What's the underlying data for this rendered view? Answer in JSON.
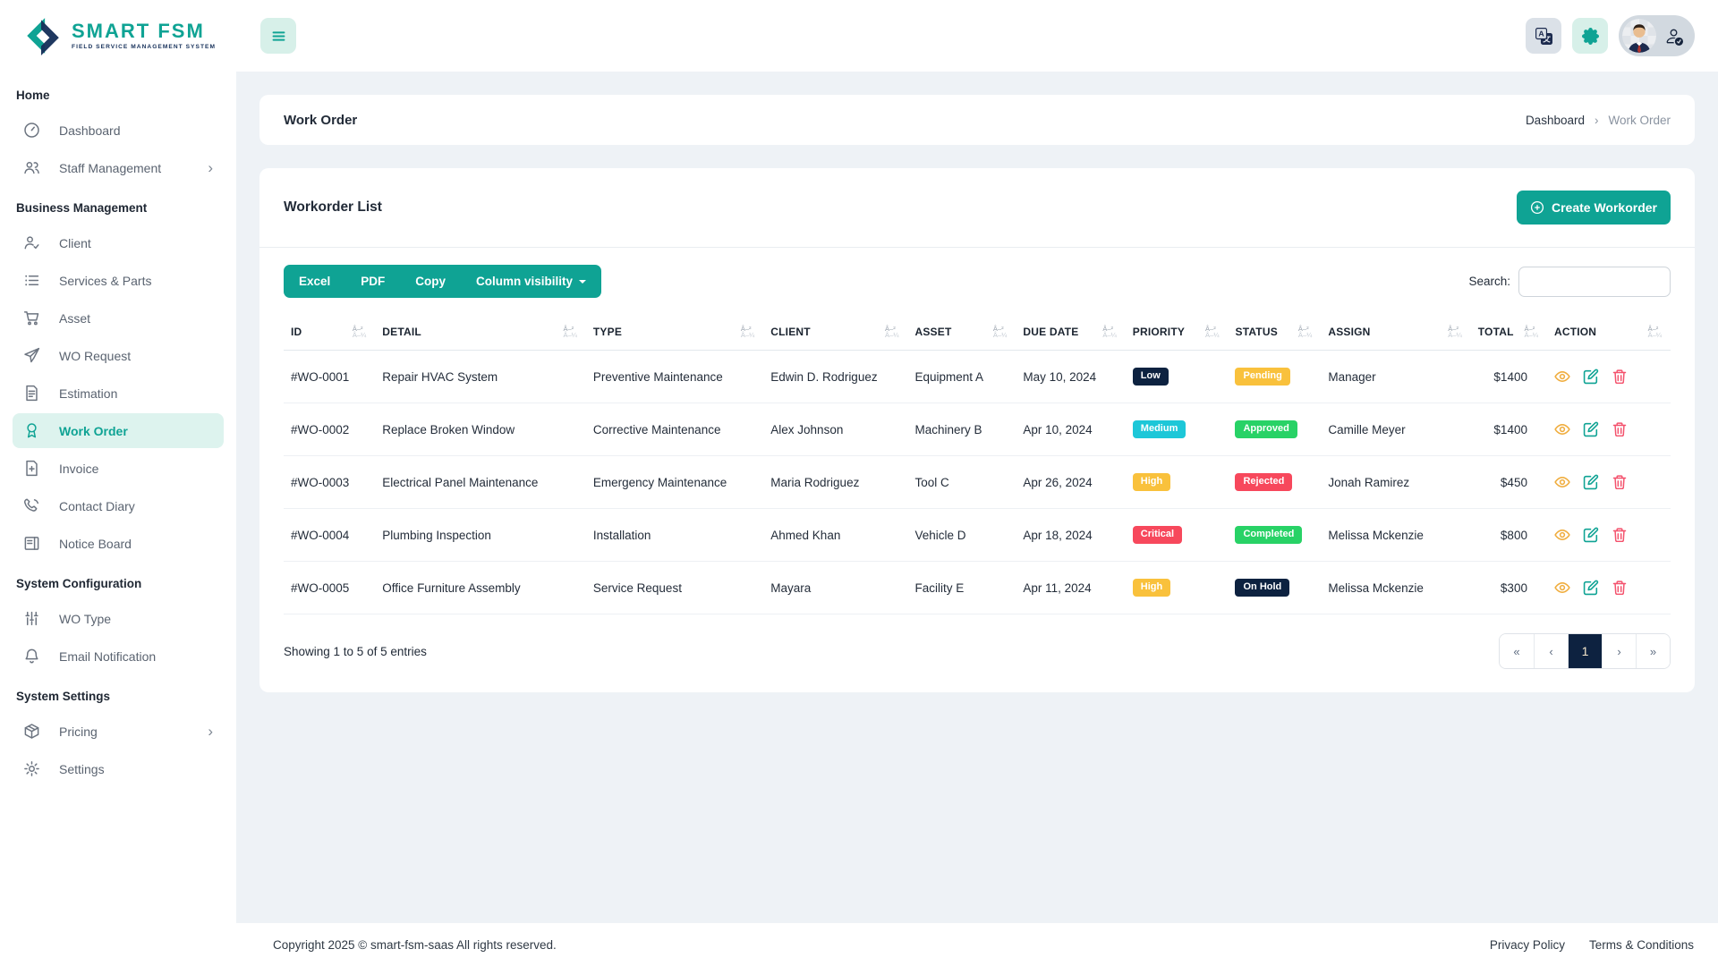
{
  "brand": {
    "name": "SMART FSM",
    "tagline": "FIELD SERVICE MANAGEMENT SYSTEM"
  },
  "sidebar": {
    "submenu_chevron": "›",
    "sections": [
      {
        "heading": "Home",
        "items": [
          {
            "label": "Dashboard",
            "icon": "speedometer-icon"
          },
          {
            "label": "Staff Management",
            "icon": "people-icon",
            "has_submenu": true
          }
        ]
      },
      {
        "heading": "Business Management",
        "items": [
          {
            "label": "Client",
            "icon": "person-check-icon"
          },
          {
            "label": "Services & Parts",
            "icon": "list-icon"
          },
          {
            "label": "Asset",
            "icon": "cart-icon"
          },
          {
            "label": "WO Request",
            "icon": "send-icon"
          },
          {
            "label": "Estimation",
            "icon": "file-text-icon"
          },
          {
            "label": "Work Order",
            "icon": "award-icon",
            "active": true
          },
          {
            "label": "Invoice",
            "icon": "file-plus-icon"
          },
          {
            "label": "Contact Diary",
            "icon": "phone-icon"
          },
          {
            "label": "Notice Board",
            "icon": "board-icon"
          }
        ]
      },
      {
        "heading": "System Configuration",
        "items": [
          {
            "label": "WO Type",
            "icon": "sliders-icon"
          },
          {
            "label": "Email Notification",
            "icon": "bell-icon"
          }
        ]
      },
      {
        "heading": "System Settings",
        "items": [
          {
            "label": "Pricing",
            "icon": "box-icon",
            "has_submenu": true
          },
          {
            "label": "Settings",
            "icon": "gear-icon"
          }
        ]
      }
    ]
  },
  "page": {
    "title": "Work Order",
    "breadcrumb": {
      "items": [
        "Dashboard",
        "Work Order"
      ],
      "separator": "›"
    }
  },
  "panel": {
    "title": "Workorder List",
    "create_button": {
      "label": "Create Workorder",
      "icon": "plus-circle-icon"
    },
    "export_buttons": [
      "Excel",
      "PDF",
      "Copy"
    ],
    "column_visibility_button": {
      "label": "Column visibility",
      "icon": "caret-down-icon"
    },
    "search": {
      "label": "Search:",
      "value": ""
    },
    "table": {
      "sort_icon": {
        "asc": "â–²",
        "desc": "â–¼"
      },
      "columns": [
        "ID",
        "DETAIL",
        "TYPE",
        "CLIENT",
        "ASSET",
        "DUE DATE",
        "PRIORITY",
        "STATUS",
        "ASSIGN",
        "TOTAL",
        "ACTION"
      ],
      "action_icons": [
        "eye-icon",
        "edit-icon",
        "trash-icon"
      ],
      "rows": [
        {
          "id": "#WO-0001",
          "detail": "Repair HVAC System",
          "type": "Preventive Maintenance",
          "client": "Edwin D. Rodriguez",
          "asset": "Equipment A",
          "due_date": "May 10, 2024",
          "priority": {
            "label": "Low",
            "color": "navy"
          },
          "status": {
            "label": "Pending",
            "color": "amber"
          },
          "assign": "Manager",
          "total": "$1400"
        },
        {
          "id": "#WO-0002",
          "detail": "Replace Broken Window",
          "type": "Corrective Maintenance",
          "client": "Alex Johnson",
          "asset": "Machinery B",
          "due_date": "Apr 10, 2024",
          "priority": {
            "label": "Medium",
            "color": "cyan"
          },
          "status": {
            "label": "Approved",
            "color": "green"
          },
          "assign": "Camille Meyer",
          "total": "$1400"
        },
        {
          "id": "#WO-0003",
          "detail": "Electrical Panel Maintenance",
          "type": "Emergency Maintenance",
          "client": "Maria Rodriguez",
          "asset": "Tool C",
          "due_date": "Apr 26, 2024",
          "priority": {
            "label": "High",
            "color": "amber"
          },
          "status": {
            "label": "Rejected",
            "color": "red"
          },
          "assign": "Jonah Ramirez",
          "total": "$450"
        },
        {
          "id": "#WO-0004",
          "detail": "Plumbing Inspection",
          "type": "Installation",
          "client": "Ahmed Khan",
          "asset": "Vehicle D",
          "due_date": "Apr 18, 2024",
          "priority": {
            "label": "Critical",
            "color": "red"
          },
          "status": {
            "label": "Completed",
            "color": "green"
          },
          "assign": "Melissa Mckenzie",
          "total": "$800"
        },
        {
          "id": "#WO-0005",
          "detail": "Office Furniture Assembly",
          "type": "Service Request",
          "client": "Mayara",
          "asset": "Facility E",
          "due_date": "Apr 11, 2024",
          "priority": {
            "label": "High",
            "color": "amber"
          },
          "status": {
            "label": "On Hold",
            "color": "navy"
          },
          "assign": "Melissa Mckenzie",
          "total": "$300"
        }
      ]
    },
    "summary": "Showing 1 to 5 of 5 entries",
    "pagination": {
      "first": "«",
      "previous": "‹",
      "pages": [
        "1"
      ],
      "active_page": "1",
      "next": "›",
      "last": "»"
    }
  },
  "footer": {
    "copyright": "Copyright 2025 © smart-fsm-saas All rights reserved.",
    "links": [
      "Privacy Policy",
      "Terms & Conditions"
    ]
  },
  "colors": {
    "accent": "#0FA394",
    "navy": "#0D2240",
    "mint": "#D7F0E9",
    "background": "#EEF2F6",
    "badge_amber": "#F9C13C",
    "badge_cyan": "#1DC7D8",
    "badge_red": "#F7485C",
    "badge_green": "#28D266",
    "badge_navy": "#0D2240",
    "action_view": "#F0AD3E",
    "action_edit": "#0FA394",
    "action_delete": "#F4516C"
  }
}
